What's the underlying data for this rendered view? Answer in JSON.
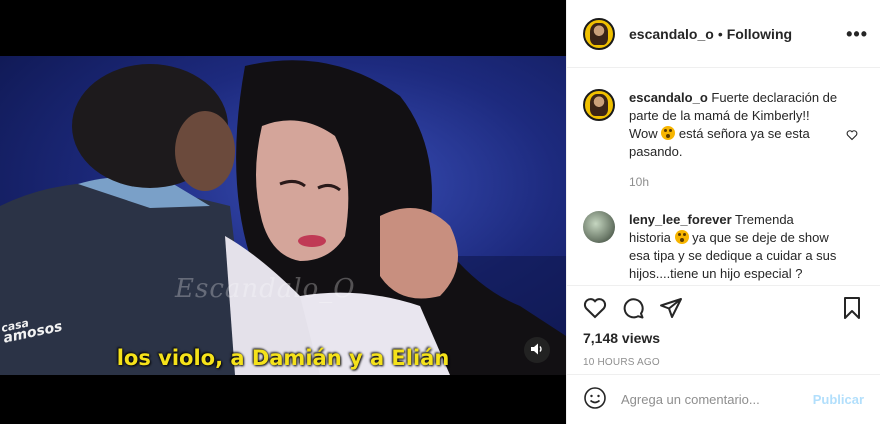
{
  "video": {
    "watermark": "Escandalo_O",
    "show_logo_line1": "casa",
    "show_logo_line2": "amosos",
    "subtitle": "los violo, a Damián y a Elián",
    "sound_icon": "speaker-icon"
  },
  "header": {
    "username": "escandalo_o",
    "separator": "•",
    "follow_status": "Following",
    "more_icon": "more-horizontal-icon"
  },
  "caption": {
    "username": "escandalo_o",
    "text_part1": "Fuerte declaración de parte de la mamá de Kimberly!! Wow",
    "text_part2": "está señora ya se esta pasando.",
    "time": "10h"
  },
  "comment": {
    "username": "leny_lee_forever",
    "text_part1": "Tremenda historia",
    "text_part2": "ya que se deje de show esa tipa y se dedique a cuidar a sus hijos....tiene un hijo especial ? Saquenme de la duda por favor?"
  },
  "actions": {
    "views": "7,148 views",
    "posted": "10 HOURS AGO"
  },
  "composer": {
    "placeholder": "Agrega un comentario...",
    "post_label": "Publicar"
  },
  "colors": {
    "link_disabled": "#b2dffc",
    "subtitle": "#f5e21a",
    "muted": "#8e8e8e"
  }
}
